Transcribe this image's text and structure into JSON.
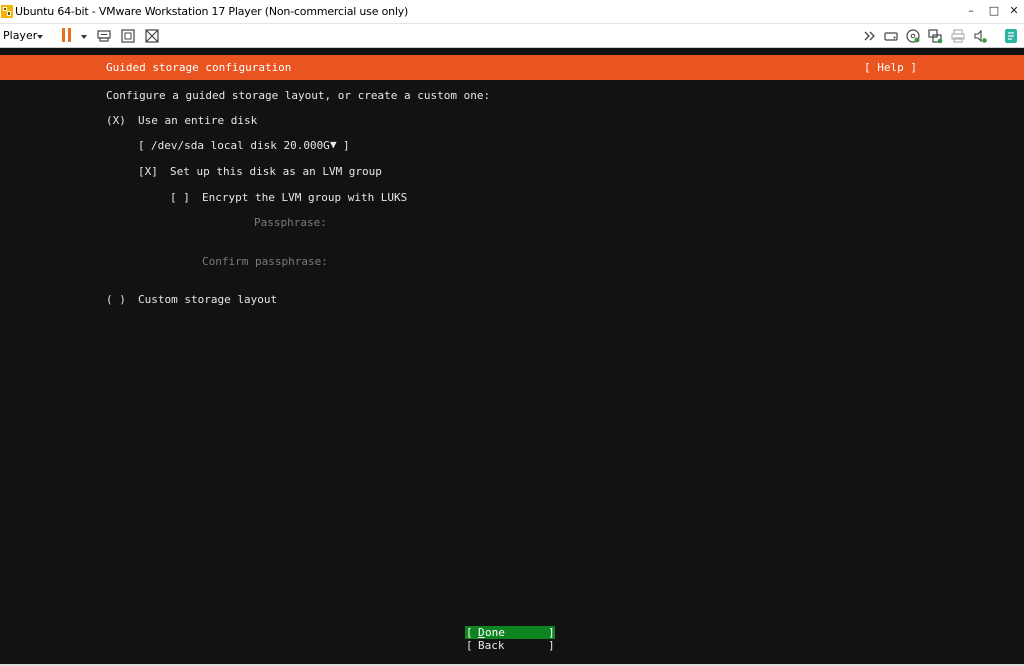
{
  "window": {
    "title": "Ubuntu 64-bit - VMware Workstation 17 Player (Non-commercial use only)",
    "min_glyph": "–",
    "max_glyph": "□",
    "close_glyph": "✕"
  },
  "toolbar": {
    "player_label": "Player"
  },
  "installer": {
    "header_title": "Guided storage configuration",
    "help_label": "[ Help ]",
    "intro": "Configure a guided storage layout, or create a custom one:",
    "entire_disk": {
      "marker": "(X)",
      "label": "Use an entire disk"
    },
    "disk_select": {
      "open": "[",
      "value": "/dev/sda local disk 20.000G",
      "arrow": "▼",
      "close": "]"
    },
    "lvm": {
      "marker": "[X]",
      "label": "Set up this disk as an LVM group"
    },
    "luks": {
      "marker": "[ ]",
      "label": "Encrypt the LVM group with LUKS"
    },
    "passphrase_label": "Passphrase:",
    "confirm_label": "Confirm passphrase:",
    "custom": {
      "marker": "( )",
      "label": "Custom storage layout"
    },
    "done_button": {
      "open": "[",
      "key": "D",
      "rest": "one",
      "close": "]"
    },
    "back_button": {
      "open": "[",
      "label": "Back",
      "close": "]"
    }
  },
  "colors": {
    "header": "#e95420",
    "done_bg": "#0e8420",
    "screen_bg": "#121212"
  }
}
